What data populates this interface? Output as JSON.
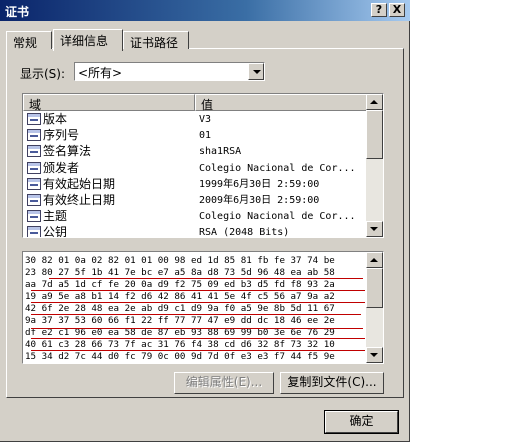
{
  "window": {
    "title": "证书",
    "help_label": "?",
    "close_label": "X"
  },
  "tabs": [
    {
      "label": "常规"
    },
    {
      "label": "详细信息"
    },
    {
      "label": "证书路径"
    }
  ],
  "show": {
    "label": "显示(S):",
    "value": "<所有>"
  },
  "list": {
    "columns": [
      "域",
      "值"
    ],
    "rows": [
      {
        "field": "版本",
        "value": "V3",
        "icon": "certificate-field-icon"
      },
      {
        "field": "序列号",
        "value": "01",
        "icon": "certificate-field-icon"
      },
      {
        "field": "签名算法",
        "value": "sha1RSA",
        "icon": "certificate-field-icon"
      },
      {
        "field": "颁发者",
        "value": "Colegio Nacional de Cor...",
        "icon": "certificate-field-icon"
      },
      {
        "field": "有效起始日期",
        "value": "1999年6月30日 2:59:00",
        "icon": "certificate-field-icon"
      },
      {
        "field": "有效终止日期",
        "value": "2009年6月30日 2:59:00",
        "icon": "certificate-field-icon"
      },
      {
        "field": "主题",
        "value": "Colegio Nacional de Cor...",
        "icon": "certificate-field-icon"
      },
      {
        "field": "公钥",
        "value": "RSA (2048 Bits)",
        "icon": "certificate-field-icon"
      }
    ]
  },
  "hex": {
    "lines": [
      "30 82 01 0a 02 82 01 01 00 98 ed 1d 85 81 fb fe 37 74 be",
      "23 80 27 5f 1b 41 7e bc e7 a5 8a d8 73 5d 96 48 ea ab 58",
      "aa 7d a5 1d cf fe 20 0a d9 f2 75 09 ed b3 d5 fd f8 93 2a",
      "19 a9 5e a8 b1 14 f2 d6 42 86 41 41 5e 4f c5 56 a7 9a a2",
      "42 6f 2e 28 48 ea 2e ab d9 c1 d9 9a f0 a5 9e 8b 5d 11 67",
      "9a 37 37 53 60 66 f1 22 ff 77 77 47 e9 dd dc 18 46 ee 2e",
      "df e2 c1 96 e0 ea 58 de 87 eb 93 88 69 99 b0 3e 6e 76 29",
      "40 61 c3 28 66 73 7f ac 31 76 f4 38 cd d6 32 8f 73 32 10",
      "15 34 d2 7c 44 d0 fc 79 0c 00 9d 7d 0f e3 e3 f7 44 f5 9e"
    ]
  },
  "buttons": {
    "edit_properties": "编辑属性(E)...",
    "copy_to_file": "复制到文件(C)...",
    "ok": "确定"
  }
}
